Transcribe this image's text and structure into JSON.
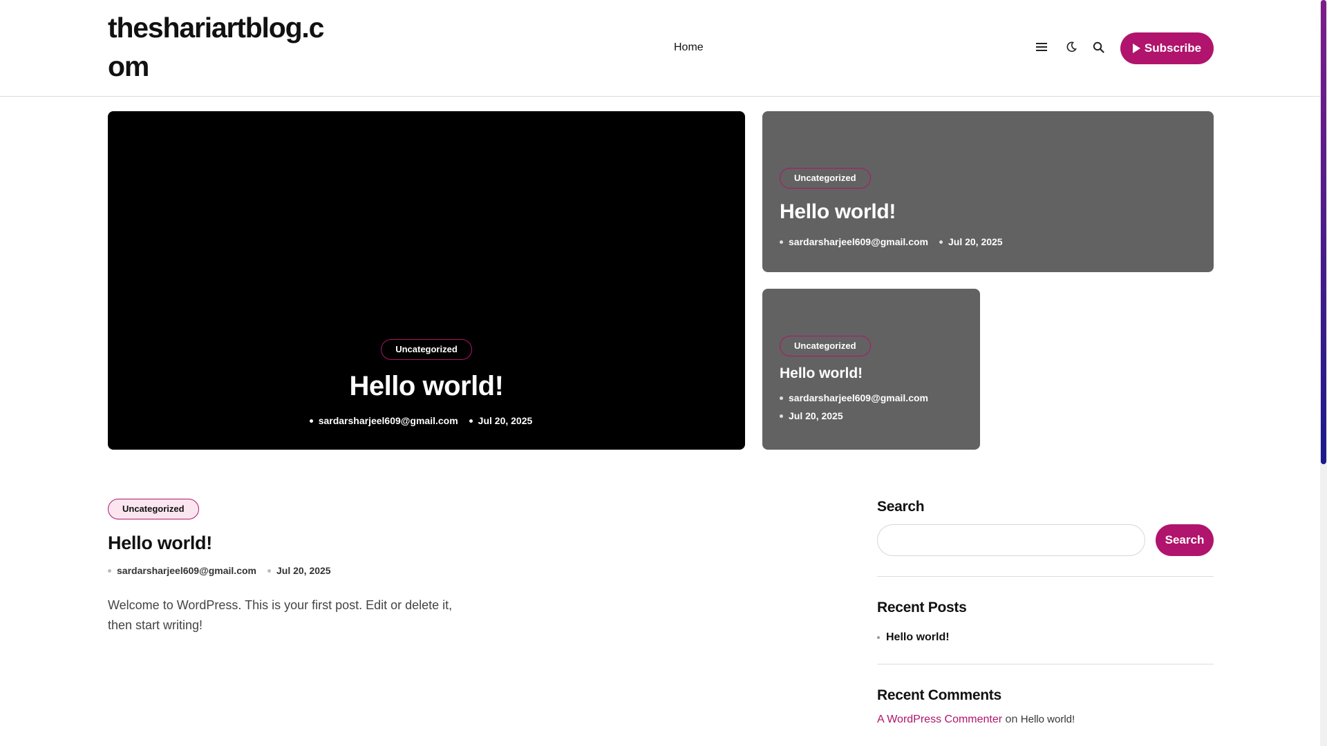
{
  "header": {
    "site_title": "theshariartblog.com",
    "nav": {
      "home": "Home"
    },
    "subscribe_label": "Subscribe"
  },
  "featured": {
    "big": {
      "category": "Uncategorized",
      "title": "Hello world!",
      "author": "sardarsharjeel609@gmail.com",
      "date": "Jul 20, 2025"
    },
    "right_top": {
      "category": "Uncategorized",
      "title": "Hello world!",
      "author": "sardarsharjeel609@gmail.com",
      "date": "Jul 20, 2025"
    },
    "right_bottom": {
      "category": "Uncategorized",
      "title": "Hello world!",
      "author": "sardarsharjeel609@gmail.com",
      "date": "Jul 20, 2025"
    }
  },
  "post": {
    "category": "Uncategorized",
    "title": "Hello world!",
    "author": "sardarsharjeel609@gmail.com",
    "date": "Jul 20, 2025",
    "excerpt": "Welcome to WordPress. This is your first post. Edit or delete it, then start writing!"
  },
  "sidebar": {
    "search": {
      "title": "Search",
      "placeholder": "",
      "button_label": "Search"
    },
    "recent_posts": {
      "title": "Recent Posts",
      "items": [
        "Hello world!"
      ]
    },
    "recent_comments": {
      "title": "Recent Comments",
      "author": "A WordPress Commenter",
      "connector": "on",
      "post": "Hello world!"
    }
  },
  "icons": {
    "menu": "menu-icon",
    "dark_mode": "moon-icon",
    "search": "search-icon",
    "subscribe": "play-icon"
  },
  "colors": {
    "accent": "#b0146c",
    "card_grey": "#626262",
    "card_dark": "#000000"
  }
}
